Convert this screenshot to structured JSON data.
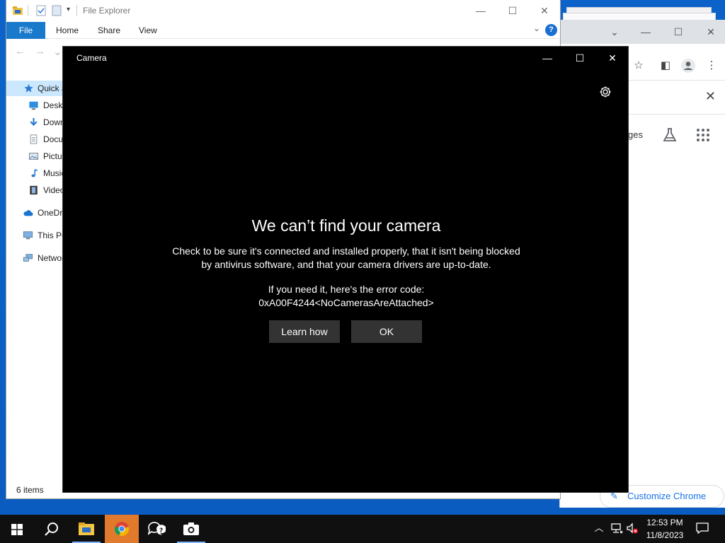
{
  "explorer": {
    "title": "File Explorer",
    "tabs": [
      "File",
      "Home",
      "Share",
      "View"
    ],
    "nav_items": [
      "Quick access",
      "Desktop",
      "Downloads",
      "Documents",
      "Pictures",
      "Music",
      "Videos",
      "OneDrive",
      "This PC",
      "Network"
    ],
    "status": "6 items"
  },
  "chrome": {
    "pages_label": "ges",
    "customize_label": "Customize Chrome"
  },
  "camera": {
    "title": "Camera",
    "heading": "We can’t find your camera",
    "body_line1": "Check to be sure it's connected and installed properly, that it isn't being blocked",
    "body_line2": "by antivirus software, and that your camera drivers are up-to-date.",
    "error_intro": "If you need it, here's the error code:",
    "error_code": "0xA00F4244<NoCamerasAreAttached>",
    "learn_button": "Learn how",
    "ok_button": "OK"
  },
  "taskbar": {
    "time": "12:53 PM",
    "date": "11/8/2023",
    "apps": [
      "start-icon",
      "search-icon",
      "file-explorer-icon",
      "chrome-icon",
      "feedback-hub-icon",
      "camera-icon"
    ]
  },
  "colors": {
    "desktop_blue": "#0b63c9",
    "file_tab_blue": "#1979ca",
    "taskbar_active": "#e17a2d",
    "camera_bg": "#000000",
    "camera_button": "#333333"
  }
}
